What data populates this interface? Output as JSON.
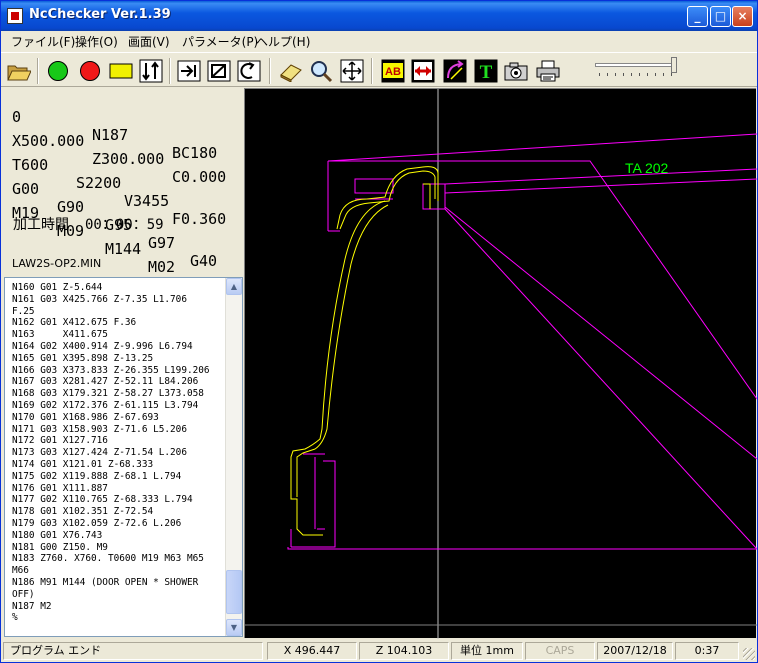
{
  "window": {
    "title": "NcChecker Ver.1.39",
    "controls": {
      "minimize": "_",
      "maximize": "□",
      "close": "×"
    }
  },
  "menu": [
    "ファイル(F)",
    "操作(O)",
    "画面(V)",
    "パラメータ(P)",
    "ヘルプ(H)"
  ],
  "toolbar": {
    "icons": [
      "open-folder-icon",
      "green-circle-icon",
      "red-circle-icon",
      "yellow-rect-icon",
      "tool-change-icon",
      "step-icon",
      "block-icon",
      "cycle-icon",
      "eraser-icon",
      "zoom-icon",
      "fit-icon",
      "ab-icon",
      "arrows-icon",
      "rotate-icon",
      "text-icon",
      "camera-icon",
      "printer-icon"
    ],
    "ab_label": "AB",
    "t_label": "T"
  },
  "status": {
    "o": "0",
    "n": "N187",
    "bc": "BC180",
    "x": "X500.000",
    "z": "Z300.000",
    "c": "C0.000",
    "t": "T600",
    "s": "S2200",
    "v": "V3455",
    "f": "F0.360",
    "g1": "G00",
    "g2": "G90",
    "g3": "G95",
    "g4": "G97",
    "g5": "G40",
    "m1": "M19",
    "m2": "M09",
    "m3": "M144",
    "m4": "M02",
    "time_label": "加工時間",
    "time_value": "00：00：59",
    "filename": "LAW2S-OP2.MIN"
  },
  "code_lines": [
    "N160 G01 Z-5.644",
    "N161 G03 X425.766 Z-7.35 L1.706",
    "F.25",
    "N162 G01 X412.675 F.36",
    "N163     X411.675",
    "N164 G02 X400.914 Z-9.996 L6.794",
    "N165 G01 X395.898 Z-13.25",
    "N166 G03 X373.833 Z-26.355 L199.206",
    "N167 G03 X281.427 Z-52.11 L84.206",
    "N168 G03 X179.321 Z-58.27 L373.058",
    "N169 G02 X172.376 Z-61.115 L3.794",
    "N170 G01 X168.986 Z-67.693",
    "N171 G03 X158.903 Z-71.6 L5.206",
    "N172 G01 X127.716",
    "N173 G03 X127.424 Z-71.54 L.206",
    "N174 G01 X121.01 Z-68.333",
    "N175 G02 X119.888 Z-68.1 L.794",
    "N176 G01 X111.887",
    "N177 G02 X110.765 Z-68.333 L.794",
    "N178 G01 X102.351 Z-72.54",
    "N179 G03 X102.059 Z-72.6 L.206",
    "N180 G01 X76.743",
    "N181 G00 Z150. M9",
    "N183 Z760. X760. T0600 M19 M63 M65",
    "M66",
    "N186 M91 M144 (DOOR OPEN * SHOWER",
    "OFF)",
    "N187 M2",
    "%"
  ],
  "canvas": {
    "tool_label": "TA 202",
    "colors": {
      "profile": "#ffff00",
      "tool_path": "#ff00ff",
      "crosshair": "#c0c0c0",
      "label": "#00ff00"
    }
  },
  "statusbar": {
    "message": "プログラム エンド",
    "x": "X 496.447",
    "z": "Z 104.103",
    "unit": "単位 1mm",
    "caps": "CAPS",
    "date": "2007/12/18",
    "time": "0:37"
  }
}
